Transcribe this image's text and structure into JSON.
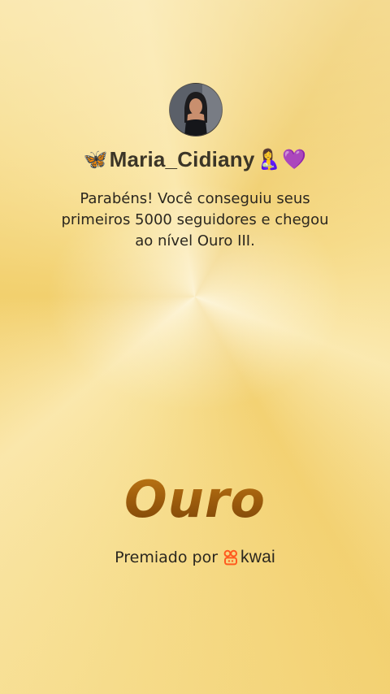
{
  "profile": {
    "username": "Maria_Cidiany",
    "prefix_emoji": "🦋",
    "suffix_emoji_1": "🤱",
    "suffix_emoji_2": "💜"
  },
  "message": {
    "line1": "Parabéns! Você conseguiu seus",
    "line2": "primeiros 5000 seguidores e chegou",
    "line3": "ao nível Ouro III."
  },
  "tier": {
    "label": "Ouro"
  },
  "footer": {
    "awarded_by": "Premiado por",
    "brand": "kwai",
    "brand_icon": "kwai-logo-icon",
    "brand_color": "#ff5a1f"
  },
  "colors": {
    "background": "#f5d77e",
    "tier_text": "#a8660f"
  }
}
